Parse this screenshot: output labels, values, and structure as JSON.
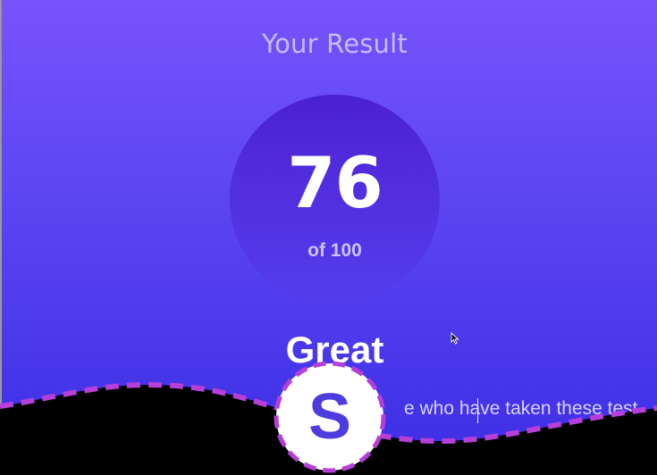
{
  "result": {
    "title": "Your Result",
    "score": "76",
    "score_max": "of 100",
    "score_fraction": 0.76,
    "rating": "Great",
    "summary": "e who have taken these test"
  },
  "logo": {
    "letter": "S"
  },
  "colors": {
    "gradient_top": "#7753fb",
    "gradient_bottom": "#3b2ee4",
    "circle": "#4b20d2",
    "dashed_border": "#b63fd9",
    "logo_letter": "#4d3ddf"
  },
  "icons": {
    "cursor": "mouse-pointer-icon",
    "logo": "s-logo-icon"
  }
}
